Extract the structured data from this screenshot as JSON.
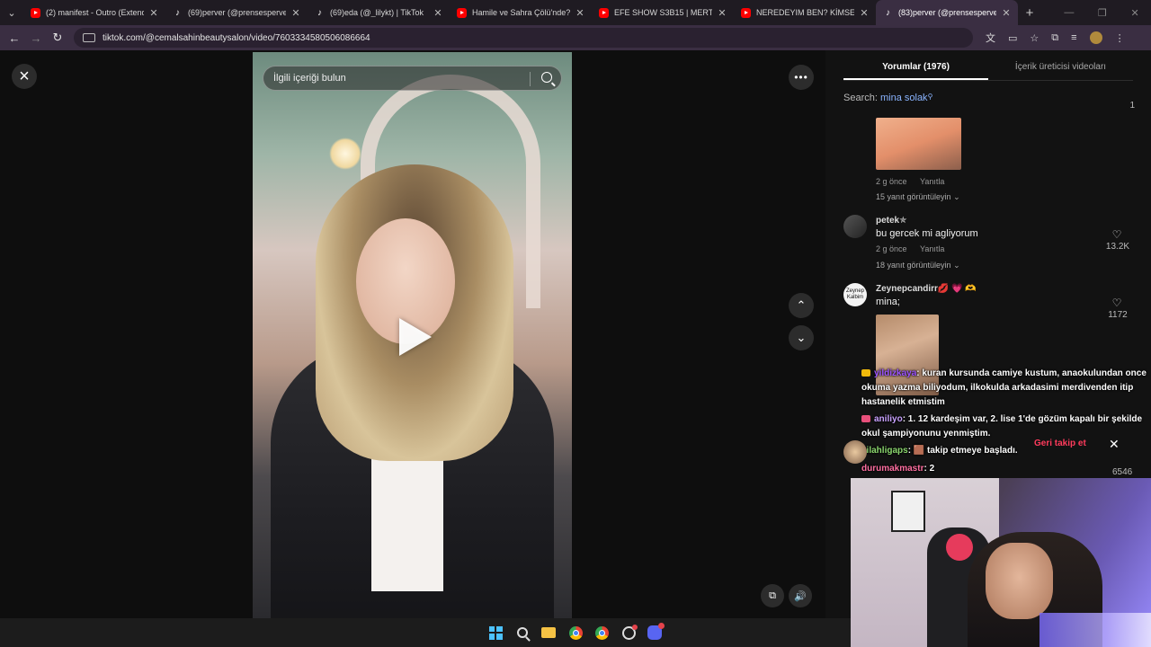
{
  "browser": {
    "tabs": [
      {
        "label": "(2) manifest - Outro (Extended",
        "favicon": "youtube-icon",
        "active": false
      },
      {
        "label": "(69)perver (@prensesperver) | T",
        "favicon": "tiktok-icon",
        "active": false
      },
      {
        "label": "(69)eda (@_lilykt) | TikTok",
        "favicon": "tiktok-icon",
        "active": false
      },
      {
        "label": "Hamile ve Sahra Çölü'nde? | M",
        "favicon": "youtube-icon",
        "active": false
      },
      {
        "label": "EFE SHOW S3B15 | MERTCAN B",
        "favicon": "youtube-icon",
        "active": false
      },
      {
        "label": "NEREDEYIM BEN? KİMSE YOK ",
        "favicon": "youtube-icon",
        "active": false
      },
      {
        "label": "(83)perver (@prensesperver) | T",
        "favicon": "tiktok-icon",
        "active": true
      }
    ],
    "url": "tiktok.com/@cemalsahinbeautysalon/video/7603334580506086664",
    "theme_color": "#3a2e42"
  },
  "video": {
    "search_placeholder": "İlgili içeriği bulun"
  },
  "comments_panel": {
    "tabs": [
      {
        "label": "Yorumlar (1976)",
        "active": true
      },
      {
        "label": "İçerik üreticisi videoları",
        "active": false
      }
    ],
    "search_label": "Search:",
    "search_query": "mina solak",
    "count": "1",
    "comment0": {
      "time": "2 g önce",
      "reply": "Yanıtla",
      "view_replies": "15 yanıt görüntüleyin"
    },
    "comment1": {
      "username": "petek✯",
      "text": "bu gercek mi agliyorum",
      "time": "2 g önce",
      "reply": "Yanıtla",
      "view_replies": "18 yanıt görüntüleyin",
      "likes": "13.2K"
    },
    "comment2": {
      "username": "Zeynepcandirr💋 💗 🫶",
      "text": "mina;",
      "avatar_text": "Zeynep Kalbim",
      "likes": "1172"
    },
    "partial_likes": "6546"
  },
  "stream_chat": [
    {
      "user": "yildizkaya",
      "message": ": kuran kursunda camiye kustum, anaokulundan once okuma yazma biliyodum, ilkokulda arkadasimi merdivenden itip hastanelik etmistim"
    },
    {
      "user": "aniliyo",
      "message": ": 1. 12 kardeşim var, 2. lise 1'de gözüm kapalı bir şekilde okul şampiyonunu yenmiştim."
    },
    {
      "user": "silahligaps",
      "message": ": 🟫 takip etmeye başladı."
    },
    {
      "user": "durumakmastr",
      "message": ": 2"
    }
  ],
  "notification": {
    "follow_back": "Geri takip et"
  },
  "colors": {
    "accent_red": "#ff3b5c",
    "link_blue": "#8ab4ff"
  }
}
